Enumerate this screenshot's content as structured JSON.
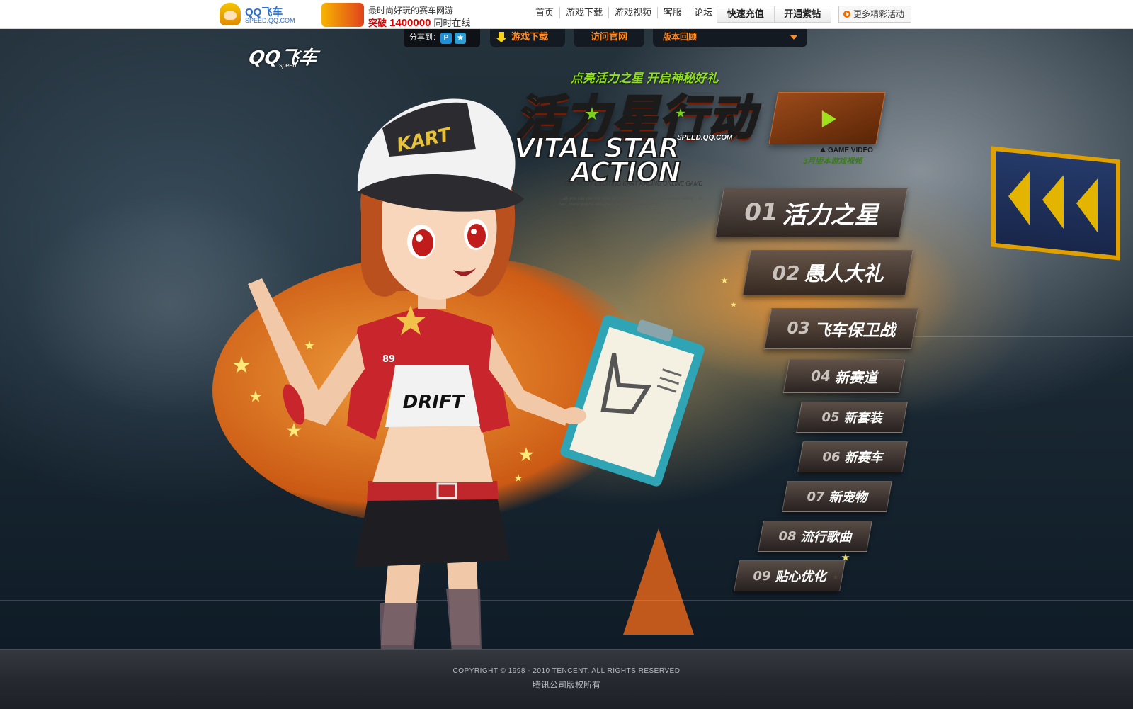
{
  "header": {
    "logo_name": "QQ飞车",
    "logo_domain": "SPEED.QQ.COM",
    "promo_line1": "最时尚好玩的赛车网游",
    "promo_hot": "突破",
    "promo_online_count": "1400000",
    "promo_online_suffix": "同时在线",
    "nav": [
      "首页",
      "游戏下载",
      "游戏视频",
      "客服",
      "论坛"
    ],
    "quick_recharge": "快速充值",
    "open_purple_diamond": "开通紫钻",
    "more_events": "更多精彩活动"
  },
  "subnav": {
    "share_label": "分享到：",
    "download_label": "游戏下载",
    "official_site_label": "访问官网",
    "version_review_label": "版本回顾"
  },
  "brand": {
    "small_logo": "QQ飞车",
    "small_logo_sub": "speed"
  },
  "hero": {
    "tagline": "点亮活力之星  开启神秘好礼",
    "title_cn": "活力星行动",
    "title_en_line1": "VITAL STAR",
    "title_en_line2": "ACTION",
    "site": "SPEED.QQ.COM",
    "slogan": "THE MOST EXCITING KART RACING ONLINE GAME",
    "fine_print": "...all, you can use only type (or mostly only type) to create breath-taking ...In fact, many graphic designers and artists take exactly"
  },
  "video": {
    "label": "GAME VIDEO",
    "subtitle": "3月版本游戏视频"
  },
  "menu": [
    {
      "num": "01",
      "label": "活力之星"
    },
    {
      "num": "02",
      "label": "愚人大礼"
    },
    {
      "num": "03",
      "label": "飞车保卫战"
    },
    {
      "num": "04",
      "label": "新赛道"
    },
    {
      "num": "05",
      "label": "新套装"
    },
    {
      "num": "06",
      "label": "新赛车"
    },
    {
      "num": "07",
      "label": "新宠物"
    },
    {
      "num": "08",
      "label": "流行歌曲"
    },
    {
      "num": "09",
      "label": "贴心优化"
    }
  ],
  "character": {
    "cap_text": "KART",
    "shirt_text": "DRIFT",
    "sleeve_number": "89"
  },
  "footer": {
    "copyright": "COPYRIGHT © 1998 - 2010 TENCENT. ALL RIGHTS RESERVED",
    "rights_cn": "腾讯公司版权所有"
  },
  "colors": {
    "accent_orange": "#ff7a17",
    "accent_green": "#8fe21a",
    "online_count_red": "#e00000",
    "link_blue": "#2a6fd0"
  },
  "icons": [
    "mascot-icon",
    "download-arrow-icon",
    "dropdown-caret-icon",
    "share-qzone-icon",
    "share-friend-icon",
    "play-icon",
    "more-events-icon"
  ]
}
